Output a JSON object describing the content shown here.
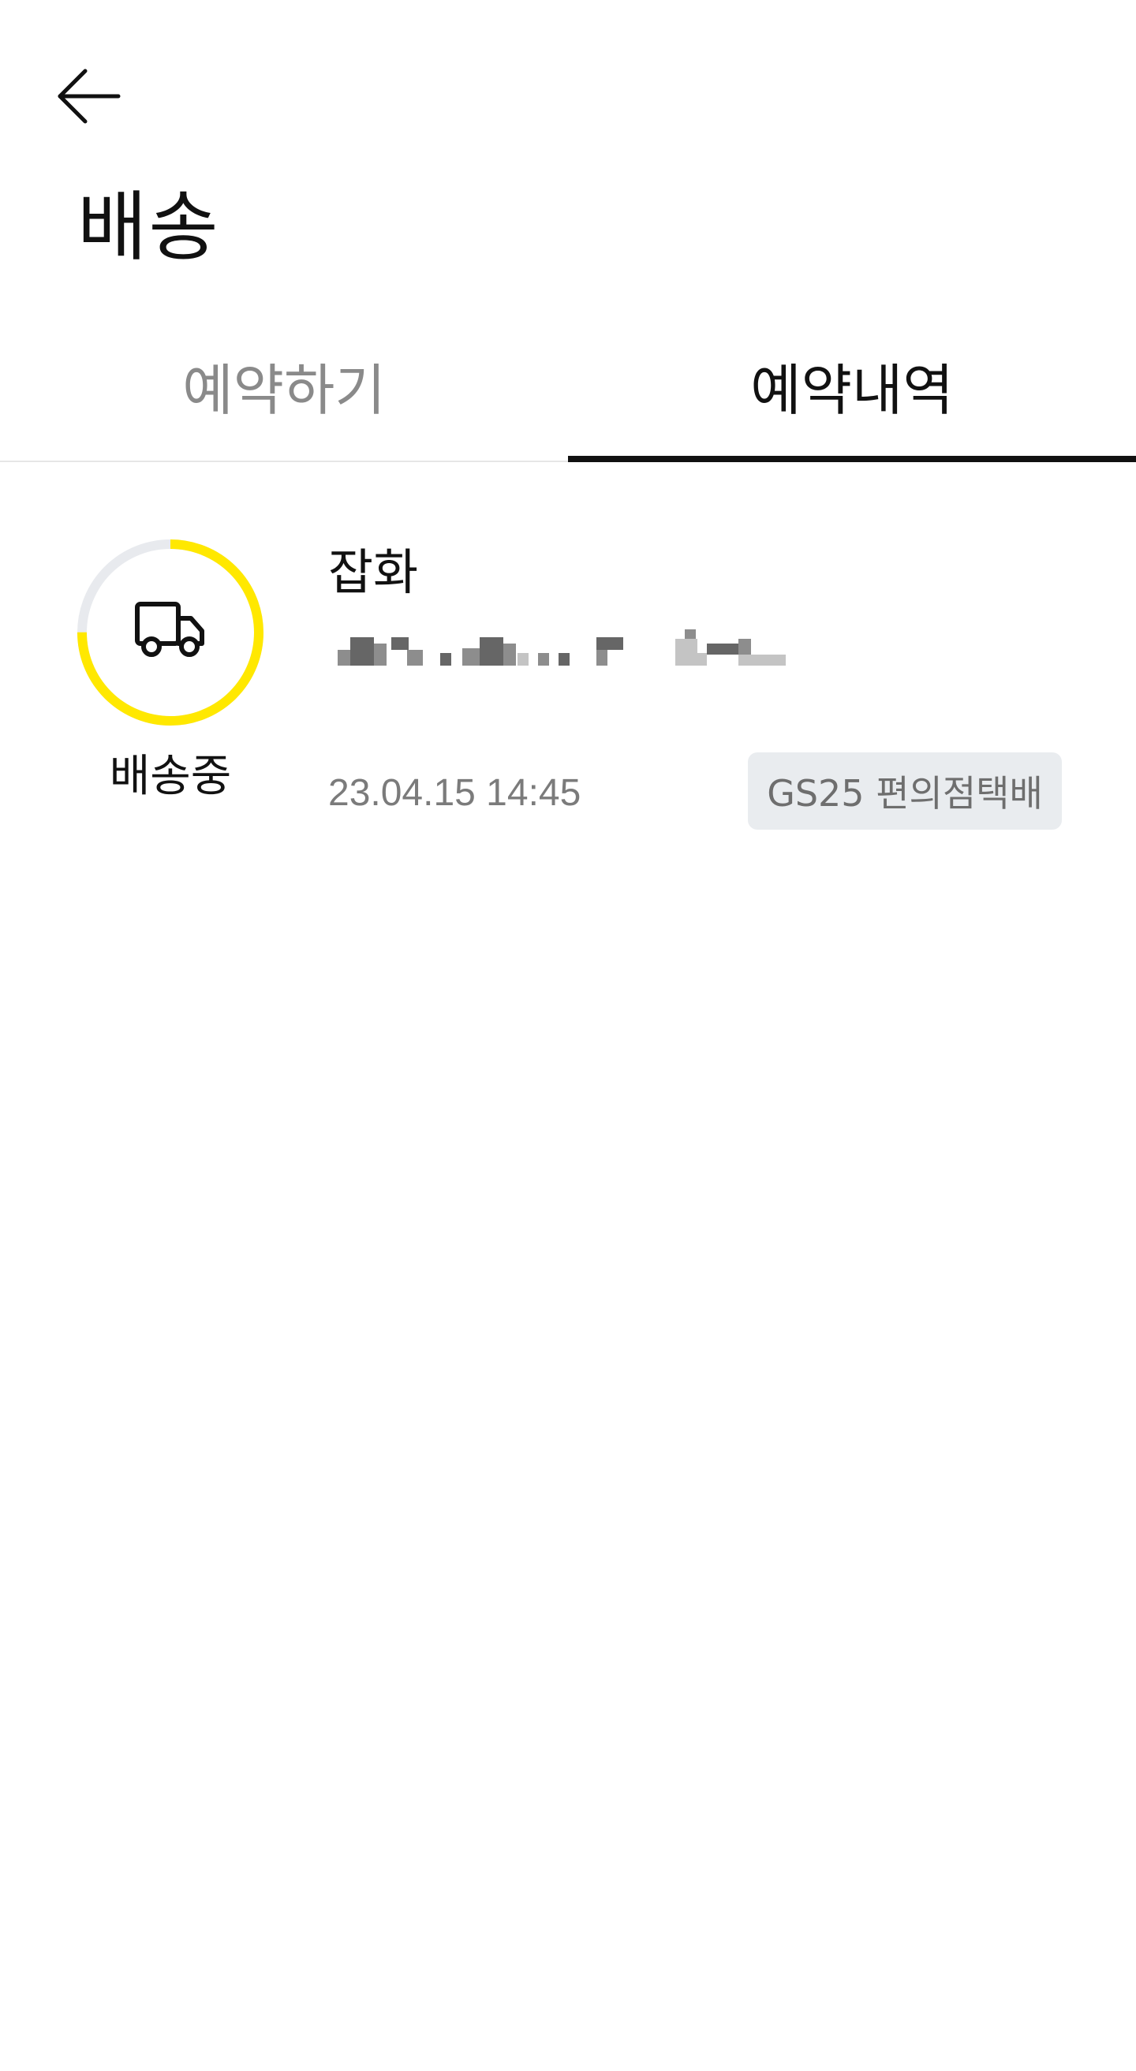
{
  "header": {
    "back_icon": "arrow-left-icon",
    "title": "배송"
  },
  "tabs": [
    {
      "label": "예약하기",
      "active": false
    },
    {
      "label": "예약내역",
      "active": true
    }
  ],
  "reservations": [
    {
      "item_name": "잡화",
      "address": "",
      "status": "배송중",
      "status_icon": "truck-icon",
      "progress": 0.75,
      "datetime": "23.04.15 14:45",
      "service": "GS25 편의점택배"
    }
  ],
  "colors": {
    "progress_fill": "#FFE800",
    "progress_track": "#E8EAEE",
    "active_tab_underline": "#111111",
    "badge_background": "#E9ECEF"
  }
}
